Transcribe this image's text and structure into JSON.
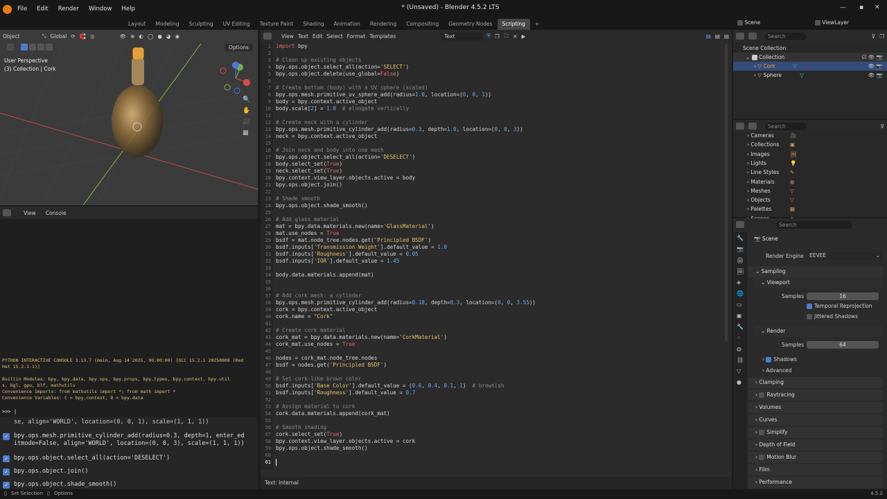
{
  "app": {
    "title": "* (Unsaved) - Blender 4.5.2 LTS",
    "menu": [
      "File",
      "Edit",
      "Render",
      "Window",
      "Help"
    ],
    "workspaces": [
      "Layout",
      "Modeling",
      "Sculpting",
      "UV Editing",
      "Texture Paint",
      "Shading",
      "Animation",
      "Rendering",
      "Compositing",
      "Geometry Nodes",
      "Scripting"
    ],
    "active_workspace": "Scripting",
    "scene": "Scene",
    "view_layer": "ViewLayer",
    "version": "4.5.2"
  },
  "viewport": {
    "mode": "Object",
    "orientation": "Global",
    "options_label": "Options",
    "info_line1": "User Perspective",
    "info_line2": "(3) Collection | Cork"
  },
  "console": {
    "menu": [
      "View",
      "Console"
    ],
    "output": [
      "PYTHON INTERACTIVE CONSOLE 3.13.7 (main, Aug 14 2025, 00:00:00) [GCC 15.2.1 20250808 (Red",
      "Hat 15.2.1-1)]",
      "",
      "Builtin Modules:       bpy, bpy.data, bpy.ops, bpy.props, bpy.types, bpy.context, bpy.util",
      "s, bgl, gpu, blf, mathutils",
      "Convenience Imports:   from mathutils import *; from math import *",
      "Convenience Variables: C = bpy.context, D = bpy.data"
    ],
    "prompt": ">>> |"
  },
  "history": [
    {
      "text": "se, align='WORLD', location=(0, 0, 1), scale=(1, 1, 1))",
      "check": false
    },
    {
      "text": "bpy.ops.mesh.primitive_cylinder_add(radius=0.3, depth=1, enter_ed\nitmode=False, align='WORLD', location=(0, 0, 3), scale=(1, 1, 1))",
      "check": true
    },
    {
      "text": "bpy.ops.object.select_all(action='DESELECT')",
      "check": true
    },
    {
      "text": "bpy.ops.object.join()",
      "check": true
    },
    {
      "text": "bpy.ops.object.shade_smooth()",
      "check": true
    }
  ],
  "text_editor": {
    "menu": [
      "View",
      "Text",
      "Edit",
      "Select",
      "Format",
      "Templates"
    ],
    "datablock": "Text",
    "footer": "Text: Internal",
    "lines": [
      [
        [
          "k",
          "import"
        ],
        [
          "d",
          " bpy"
        ]
      ],
      [],
      [
        [
          "c",
          "# Clean up existing objects"
        ]
      ],
      [
        [
          "d",
          "bpy.ops.object.select_all(action="
        ],
        [
          "s",
          "'SELECT'"
        ],
        [
          "d",
          ")"
        ]
      ],
      [
        [
          "d",
          "bpy.ops.object.delete(use_global="
        ],
        [
          "k",
          "False"
        ],
        [
          "d",
          ")"
        ]
      ],
      [],
      [
        [
          "c",
          "# Create bottom (body) with a UV sphere (scaled)"
        ]
      ],
      [
        [
          "d",
          "bpy.ops.mesh.primitive_uv_sphere_add(radius="
        ],
        [
          "n",
          "1.0"
        ],
        [
          "d",
          ", location=("
        ],
        [
          "n",
          "0"
        ],
        [
          "d",
          ", "
        ],
        [
          "n",
          "0"
        ],
        [
          "d",
          ", "
        ],
        [
          "n",
          "1"
        ],
        [
          "d",
          "))"
        ]
      ],
      [
        [
          "d",
          "body = bpy.context.active_object"
        ]
      ],
      [
        [
          "d",
          "body.scale["
        ],
        [
          "n",
          "2"
        ],
        [
          "d",
          "] = "
        ],
        [
          "n",
          "1.8"
        ],
        [
          "c",
          "  # elongate vertically"
        ]
      ],
      [],
      [
        [
          "c",
          "# Create neck with a cylinder"
        ]
      ],
      [
        [
          "d",
          "bpy.ops.mesh.primitive_cylinder_add(radius="
        ],
        [
          "n",
          "0.3"
        ],
        [
          "d",
          ", depth="
        ],
        [
          "n",
          "1.0"
        ],
        [
          "d",
          ", location=("
        ],
        [
          "n",
          "0"
        ],
        [
          "d",
          ", "
        ],
        [
          "n",
          "0"
        ],
        [
          "d",
          ", "
        ],
        [
          "n",
          "3"
        ],
        [
          "d",
          "))"
        ]
      ],
      [
        [
          "d",
          "neck = bpy.context.active_object"
        ]
      ],
      [],
      [
        [
          "c",
          "# Join neck and body into one mesh"
        ]
      ],
      [
        [
          "d",
          "bpy.ops.object.select_all(action="
        ],
        [
          "s",
          "'DESELECT'"
        ],
        [
          "d",
          ")"
        ]
      ],
      [
        [
          "d",
          "body.select_set("
        ],
        [
          "k",
          "True"
        ],
        [
          "d",
          ")"
        ]
      ],
      [
        [
          "d",
          "neck.select_set("
        ],
        [
          "k",
          "True"
        ],
        [
          "d",
          ")"
        ]
      ],
      [
        [
          "d",
          "bpy.context.view_layer.objects.active = body"
        ]
      ],
      [
        [
          "d",
          "bpy.ops.object.join()"
        ]
      ],
      [],
      [
        [
          "c",
          "# Shade smooth"
        ]
      ],
      [
        [
          "d",
          "bpy.ops.object.shade_smooth()"
        ]
      ],
      [],
      [
        [
          "c",
          "# Add glass material"
        ]
      ],
      [
        [
          "d",
          "mat = bpy.data.materials.new(name="
        ],
        [
          "s",
          "'GlassMaterial'"
        ],
        [
          "d",
          ")"
        ]
      ],
      [
        [
          "d",
          "mat.use_nodes = "
        ],
        [
          "k",
          "True"
        ]
      ],
      [
        [
          "d",
          "bsdf = mat.node_tree.nodes.get("
        ],
        [
          "s",
          "'Principled BSDF'"
        ],
        [
          "d",
          ")"
        ]
      ],
      [
        [
          "d",
          "bsdf.inputs["
        ],
        [
          "s",
          "'Transmission Weight'"
        ],
        [
          "d",
          "].default_value = "
        ],
        [
          "n",
          "1.0"
        ]
      ],
      [
        [
          "d",
          "bsdf.inputs["
        ],
        [
          "s",
          "'Roughness'"
        ],
        [
          "d",
          "].default_value = "
        ],
        [
          "n",
          "0.05"
        ]
      ],
      [
        [
          "d",
          "bsdf.inputs["
        ],
        [
          "s",
          "'IOR'"
        ],
        [
          "d",
          "].default_value = "
        ],
        [
          "n",
          "1.45"
        ]
      ],
      [],
      [
        [
          "d",
          "body.data.materials.append(mat)"
        ]
      ],
      [],
      [],
      [
        [
          "c",
          "# Add cork mesh: a cylinder"
        ]
      ],
      [
        [
          "d",
          "bpy.ops.mesh.primitive_cylinder_add(radius="
        ],
        [
          "n",
          "0.18"
        ],
        [
          "d",
          ", depth="
        ],
        [
          "n",
          "0.3"
        ],
        [
          "d",
          ", location=("
        ],
        [
          "n",
          "0"
        ],
        [
          "d",
          ", "
        ],
        [
          "n",
          "0"
        ],
        [
          "d",
          ", "
        ],
        [
          "n",
          "3.55"
        ],
        [
          "d",
          "))"
        ]
      ],
      [
        [
          "d",
          "cork = bpy.context.active_object"
        ]
      ],
      [
        [
          "d",
          "cork.name = "
        ],
        [
          "s",
          "\"Cork\""
        ]
      ],
      [],
      [
        [
          "c",
          "# Create cork material"
        ]
      ],
      [
        [
          "d",
          "cork_mat = bpy.data.materials.new(name="
        ],
        [
          "s",
          "'CorkMaterial'"
        ],
        [
          "d",
          ")"
        ]
      ],
      [
        [
          "d",
          "cork_mat.use_nodes = "
        ],
        [
          "k",
          "True"
        ]
      ],
      [],
      [
        [
          "d",
          "nodes = cork_mat.node_tree.nodes"
        ]
      ],
      [
        [
          "d",
          "bsdf = nodes.get("
        ],
        [
          "s",
          "'Principled BSDF'"
        ],
        [
          "d",
          ")"
        ]
      ],
      [],
      [
        [
          "c",
          "# Set cork-like brown color"
        ]
      ],
      [
        [
          "d",
          "bsdf.inputs["
        ],
        [
          "s",
          "'Base Color'"
        ],
        [
          "d",
          "].default_value = ("
        ],
        [
          "n",
          "0.6"
        ],
        [
          "d",
          ", "
        ],
        [
          "n",
          "0.4"
        ],
        [
          "d",
          ", "
        ],
        [
          "n",
          "0.1"
        ],
        [
          "d",
          ", "
        ],
        [
          "n",
          "1"
        ],
        [
          "d",
          ")"
        ],
        [
          "c",
          "  # brownish"
        ]
      ],
      [
        [
          "d",
          "bsdf.inputs["
        ],
        [
          "s",
          "'Roughness'"
        ],
        [
          "d",
          "].default_value = "
        ],
        [
          "n",
          "0.7"
        ]
      ],
      [],
      [
        [
          "c",
          "# Assign material to cork"
        ]
      ],
      [
        [
          "d",
          "cork.data.materials.append(cork_mat)"
        ]
      ],
      [],
      [
        [
          "c",
          "# Smooth shading"
        ]
      ],
      [
        [
          "d",
          "cork.select_set("
        ],
        [
          "k",
          "True"
        ],
        [
          "d",
          ")"
        ]
      ],
      [
        [
          "d",
          "bpy.context.view_layer.objects.active = cork"
        ]
      ],
      [
        [
          "d",
          "bpy.ops.object.shade_smooth()"
        ]
      ],
      [],
      []
    ],
    "colors": {
      "d": "#d8d8d8",
      "k": "#e06c6c",
      "s": "#e8c26a",
      "n": "#6aaef0",
      "c": "#8a8a8a"
    }
  },
  "outliner": {
    "search_placeholder": "Search",
    "scene_collection": "Scene Collection",
    "collection": "Collection",
    "items": [
      "Cork",
      "Sphere"
    ]
  },
  "datablocks": {
    "search_placeholder": "Search",
    "items": [
      "Cameras",
      "Collections",
      "Images",
      "Lights",
      "Line Styles",
      "Materials",
      "Meshes",
      "Objects",
      "Palettes",
      "Scenes"
    ]
  },
  "properties": {
    "search_placeholder": "Search",
    "scene": "Scene",
    "render_engine_label": "Render Engine",
    "render_engine": "EEVEE",
    "sampling": "Sampling",
    "viewport": "Viewport",
    "samples_label": "Samples",
    "viewport_samples": "16",
    "temporal_reprojection": "Temporal Reprojection",
    "jittered_shadows": "Jittered Shadows",
    "render": "Render",
    "render_samples": "64",
    "shadows": "Shadows",
    "advanced": "Advanced",
    "sections": [
      "Clamping",
      "Raytracing",
      "Volumes",
      "Curves",
      "Simplify",
      "Depth of Field",
      "Motion Blur",
      "Film",
      "Performance"
    ]
  },
  "statusbar": {
    "left1": "Set Selection",
    "left2": "Options",
    "right": "4.5.2"
  }
}
